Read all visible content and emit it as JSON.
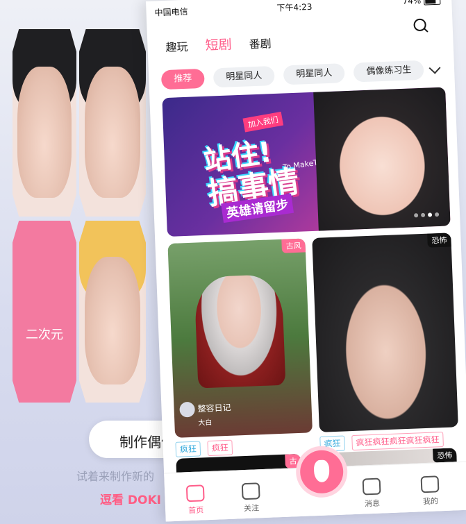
{
  "background": {
    "tile_label": "二次元",
    "make_idol_button": "制作偶像",
    "hint_text": "试着来制作新的",
    "doki_text": "逗看 DOKI ID"
  },
  "status_bar": {
    "carrier": "中国电信",
    "time": "下午4:23",
    "battery": "74%"
  },
  "top_tabs": [
    {
      "label": "趣玩"
    },
    {
      "label": "短剧"
    },
    {
      "label": "番剧"
    }
  ],
  "categories": [
    {
      "label": "推荐"
    },
    {
      "label": "明星同人"
    },
    {
      "label": "明星同人"
    },
    {
      "label": "偶像练习生"
    }
  ],
  "banner": {
    "join": "加入我们",
    "line1": "站住!",
    "line2": "搞事情",
    "english": "To MakeThings",
    "line3": "英雄请留步"
  },
  "cards": [
    {
      "tag": "古风",
      "author": "整容日记",
      "author_sub": "大白",
      "keywords": [
        "疯狂",
        "疯狂"
      ]
    },
    {
      "tag": "恐怖",
      "keywords": [
        "疯狂",
        "疯狂疯狂疯狂疯狂疯狂"
      ]
    },
    {
      "tag": "古"
    },
    {
      "tag": "恐怖"
    }
  ],
  "bottom_tabs": [
    {
      "label": "首页",
      "icon": "home-icon"
    },
    {
      "label": "关注",
      "icon": "follow-icon"
    },
    {
      "label": "消息",
      "icon": "message-icon"
    },
    {
      "label": "我的",
      "icon": "profile-icon"
    }
  ],
  "colors": {
    "accent": "#ff6d95",
    "tag_blue": "#2fa8dc"
  }
}
